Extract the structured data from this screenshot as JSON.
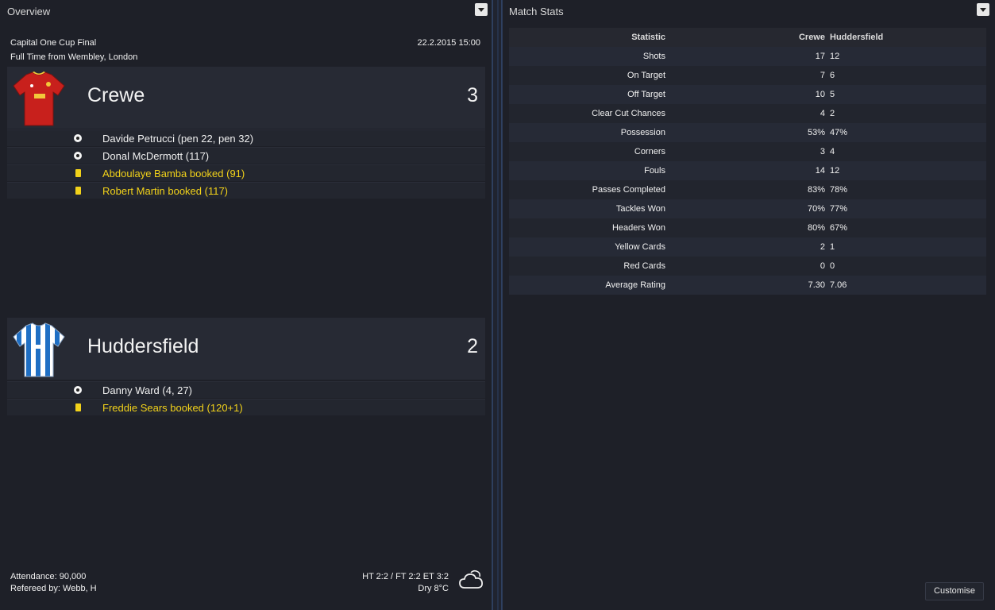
{
  "overview": {
    "title": "Overview",
    "competition": "Capital One Cup Final",
    "datetime": "22.2.2015 15:00",
    "status": "Full Time from Wembley, London",
    "home": {
      "name": "Crewe",
      "score": "3",
      "events": [
        {
          "type": "goal",
          "icon": "football-icon",
          "text": "Davide Petrucci (pen 22, pen 32)"
        },
        {
          "type": "goal",
          "icon": "football-icon",
          "text": "Donal McDermott (117)"
        },
        {
          "type": "booking",
          "icon": "yellow-card-icon",
          "text": "Abdoulaye Bamba booked (91)"
        },
        {
          "type": "booking",
          "icon": "yellow-card-icon",
          "text": "Robert Martin booked (117)"
        }
      ],
      "shirt_colors": {
        "primary": "#c8201c",
        "secondary": "#f2c83a"
      }
    },
    "away": {
      "name": "Huddersfield",
      "score": "2",
      "events": [
        {
          "type": "goal",
          "icon": "football-icon",
          "text": "Danny Ward (4, 27)"
        },
        {
          "type": "booking",
          "icon": "yellow-card-icon",
          "text": "Freddie Sears booked (120+1)"
        }
      ],
      "shirt_colors": {
        "primary": "#1f6fc4",
        "secondary": "#ffffff"
      }
    },
    "attendance": "Attendance: 90,000",
    "referee": "Refereed by: Webb, H",
    "score_summary": "HT 2:2 / FT 2:2 ET 3:2",
    "weather": "Dry 8°C",
    "weather_icon": "cloud-icon"
  },
  "stats": {
    "title": "Match Stats",
    "header": {
      "statistic": "Statistic",
      "home": "Crewe",
      "away": "Huddersfield"
    },
    "rows": [
      {
        "label": "Shots",
        "home": "17",
        "away": "12"
      },
      {
        "label": "On Target",
        "home": "7",
        "away": "6"
      },
      {
        "label": "Off Target",
        "home": "10",
        "away": "5"
      },
      {
        "label": "Clear Cut Chances",
        "home": "4",
        "away": "2"
      },
      {
        "label": "Possession",
        "home": "53%",
        "away": "47%"
      },
      {
        "label": "Corners",
        "home": "3",
        "away": "4"
      },
      {
        "label": "Fouls",
        "home": "14",
        "away": "12"
      },
      {
        "label": "Passes Completed",
        "home": "83%",
        "away": "78%"
      },
      {
        "label": "Tackles Won",
        "home": "70%",
        "away": "77%"
      },
      {
        "label": "Headers Won",
        "home": "80%",
        "away": "67%"
      },
      {
        "label": "Yellow Cards",
        "home": "2",
        "away": "1"
      },
      {
        "label": "Red Cards",
        "home": "0",
        "away": "0"
      },
      {
        "label": "Average Rating",
        "home": "7.30",
        "away": "7.06"
      }
    ],
    "customise_label": "Customise"
  },
  "colors": {
    "accent_yellow": "#f2d21a",
    "panel_bg": "#1e2028",
    "divider": "#2c3d5a"
  }
}
